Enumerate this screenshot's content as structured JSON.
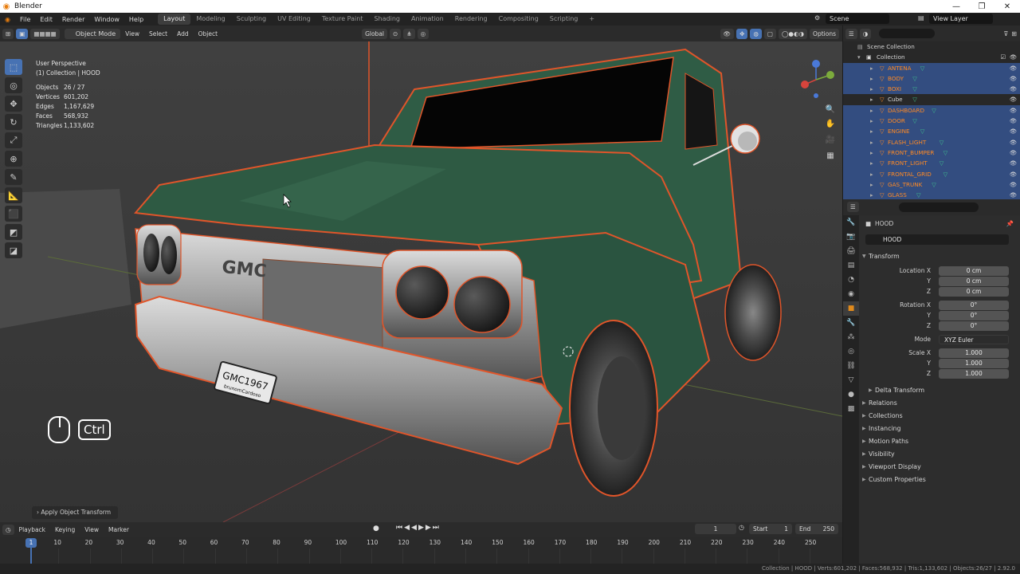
{
  "window": {
    "title": "Blender",
    "controls": [
      "—",
      "❐",
      "✕"
    ]
  },
  "menu": {
    "items": [
      "File",
      "Edit",
      "Render",
      "Window",
      "Help"
    ],
    "workspaces": [
      "Layout",
      "Modeling",
      "Sculpting",
      "UV Editing",
      "Texture Paint",
      "Shading",
      "Animation",
      "Rendering",
      "Compositing",
      "Scripting"
    ],
    "active_workspace": "Layout",
    "add_tab": "+",
    "scene": "Scene",
    "view_layer": "View Layer"
  },
  "viewport_header": {
    "mode": "Object Mode",
    "menus": [
      "View",
      "Select",
      "Add",
      "Object"
    ],
    "orientation": "Global",
    "options": "Options"
  },
  "viewport": {
    "view_name": "User Perspective",
    "collection_info": "(1) Collection | HOOD",
    "stats": [
      {
        "k": "Objects",
        "v": "26 / 27"
      },
      {
        "k": "Vertices",
        "v": "601,202"
      },
      {
        "k": "Edges",
        "v": "1,167,629"
      },
      {
        "k": "Faces",
        "v": "568,932"
      },
      {
        "k": "Triangles",
        "v": "1,133,602"
      }
    ],
    "operator_panel": "Apply Object Transform",
    "key_hint": "Ctrl",
    "license_plate": "GMC1967",
    "license_sub": "brunomCardoso",
    "grille_text": "GMC"
  },
  "timeline": {
    "menus": [
      "Playback",
      "Keying",
      "View",
      "Marker"
    ],
    "current_frame": "1",
    "start_label": "Start",
    "start": "1",
    "end_label": "End",
    "end": "250",
    "ticks": [
      "1",
      "10",
      "20",
      "30",
      "40",
      "50",
      "60",
      "70",
      "80",
      "90",
      "100",
      "110",
      "120",
      "130",
      "140",
      "150",
      "160",
      "170",
      "180",
      "190",
      "200",
      "210",
      "220",
      "230",
      "240",
      "250"
    ]
  },
  "outliner": {
    "scene_collection": "Scene Collection",
    "collection": "Collection",
    "items": [
      {
        "name": "ANTENA",
        "selected": true
      },
      {
        "name": "BODY",
        "selected": true
      },
      {
        "name": "BOXI",
        "selected": true
      },
      {
        "name": "Cube",
        "selected": false
      },
      {
        "name": "DASHBOARD",
        "selected": true
      },
      {
        "name": "DOOR",
        "selected": true
      },
      {
        "name": "ENGINE",
        "selected": true
      },
      {
        "name": "FLASH_LIGHT",
        "selected": true
      },
      {
        "name": "FRONT_BUMPER",
        "selected": true
      },
      {
        "name": "FRONT_LIGHT",
        "selected": true
      },
      {
        "name": "FRONTAL_GRID",
        "selected": true
      },
      {
        "name": "GAS_TRUNK",
        "selected": true
      },
      {
        "name": "GLASS",
        "selected": true
      }
    ]
  },
  "properties": {
    "object_name": "HOOD",
    "object_field": "HOOD",
    "transform_label": "Transform",
    "location": {
      "label": "Location X",
      "x": "0 cm",
      "y": "0 cm",
      "z": "0 cm"
    },
    "rotation": {
      "label": "Rotation X",
      "x": "0°",
      "y": "0°",
      "z": "0°"
    },
    "mode_label": "Mode",
    "mode_value": "XYZ Euler",
    "scale": {
      "label": "Scale X",
      "x": "1.000",
      "y": "1.000",
      "z": "1.000"
    },
    "axis_y": "Y",
    "axis_z": "Z",
    "delta": "Delta Transform",
    "sections": [
      "Relations",
      "Collections",
      "Instancing",
      "Motion Paths",
      "Visibility",
      "Viewport Display",
      "Custom Properties"
    ]
  },
  "statusbar": "Collection | HOOD | Verts:601,202 | Faces:568,932 | Tris:1,133,602 | Objects:26/27 | 2.92.0",
  "colors": {
    "accent": "#4772b3",
    "selection": "#ff8a24",
    "truck_body": "#2e5a43",
    "outliner_selected": "#334d80"
  }
}
